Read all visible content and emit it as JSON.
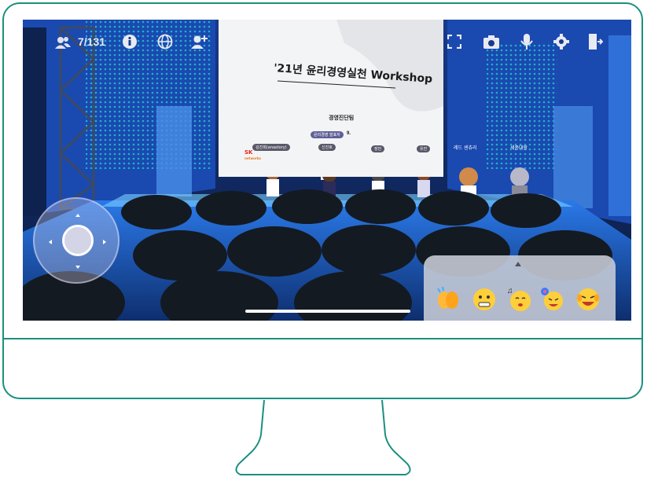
{
  "topbar": {
    "participants_icon": "users-icon",
    "participants_count": "7/131",
    "info_icon": "info-icon",
    "language_icon": "globe-icon",
    "add_user_icon": "add-user-icon",
    "fullscreen_icon": "fullscreen-icon",
    "camera_icon": "camera-icon",
    "mic_icon": "microphone-icon",
    "settings_icon": "gear-icon",
    "exit_icon": "exit-icon"
  },
  "slide": {
    "title": "'21년 윤리경영실천 Workshop",
    "subtitle": "경영진단팀",
    "date_fragment": "9.",
    "logo_line1": "SK",
    "logo_line2": "networks"
  },
  "nametags": [
    "김진희(anastory)",
    "신진호",
    "장민",
    "유진"
  ],
  "presenter_tag": "윤리경영 발표자",
  "side_tags": [
    "레드 센츄리",
    "세종대왕"
  ],
  "controls": {
    "joystick": "joystick-control",
    "emoji_expand_icon": "chevron-up-icon",
    "emojis": [
      "clapping-hands-emoji",
      "grimace-emoji",
      "singing-emoji",
      "cheering-emoji",
      "laughing-emoji"
    ]
  },
  "colors": {
    "frame": "#1a8f80",
    "stage_blue": "#1e5fd6",
    "panel": "#c8cdd7"
  }
}
